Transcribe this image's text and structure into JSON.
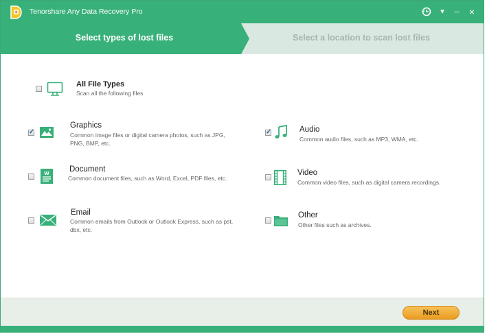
{
  "app": {
    "title": "Tenorshare Any Data Recovery Pro",
    "accent": "#38b07a"
  },
  "titlebar_icons": [
    "history-icon",
    "dropdown-icon",
    "minimize-icon",
    "close-icon"
  ],
  "titlebar_glyphs": {
    "dropdown": "▾",
    "minimize": "–",
    "close": "×"
  },
  "steps": [
    {
      "label": "Select types of lost files",
      "active": true
    },
    {
      "label": "Select a location to scan lost files",
      "active": false
    }
  ],
  "all_types": {
    "label": "All File Types",
    "desc": "Scan all the following files",
    "checked": false,
    "icon": "monitor-icon"
  },
  "types": [
    {
      "key": "graphics",
      "label": "Graphics",
      "desc": "Common image files or digital camera photos, such as JPG, PNG, BMP, etc.",
      "checked": true,
      "icon": "image-icon"
    },
    {
      "key": "audio",
      "label": "Audio",
      "desc": "Common audio files, such as MP3, WMA, etc.",
      "checked": true,
      "icon": "music-note-icon"
    },
    {
      "key": "document",
      "label": "Document",
      "desc": "Common document files, such as Word, Excel, PDF files, etc.",
      "checked": false,
      "icon": "word-document-icon"
    },
    {
      "key": "video",
      "label": "Video",
      "desc": "Common video files, such as digital camera recordings.",
      "checked": false,
      "icon": "film-icon"
    },
    {
      "key": "email",
      "label": "Email",
      "desc": "Common emails from Outlook or Outlook Express, such as pst, dbx, etc.",
      "checked": false,
      "icon": "envelope-icon"
    },
    {
      "key": "other",
      "label": "Other",
      "desc": "Other files such as archives.",
      "checked": false,
      "icon": "folder-icon"
    }
  ],
  "checkmark": "✓",
  "footer": {
    "next_label": "Next"
  }
}
